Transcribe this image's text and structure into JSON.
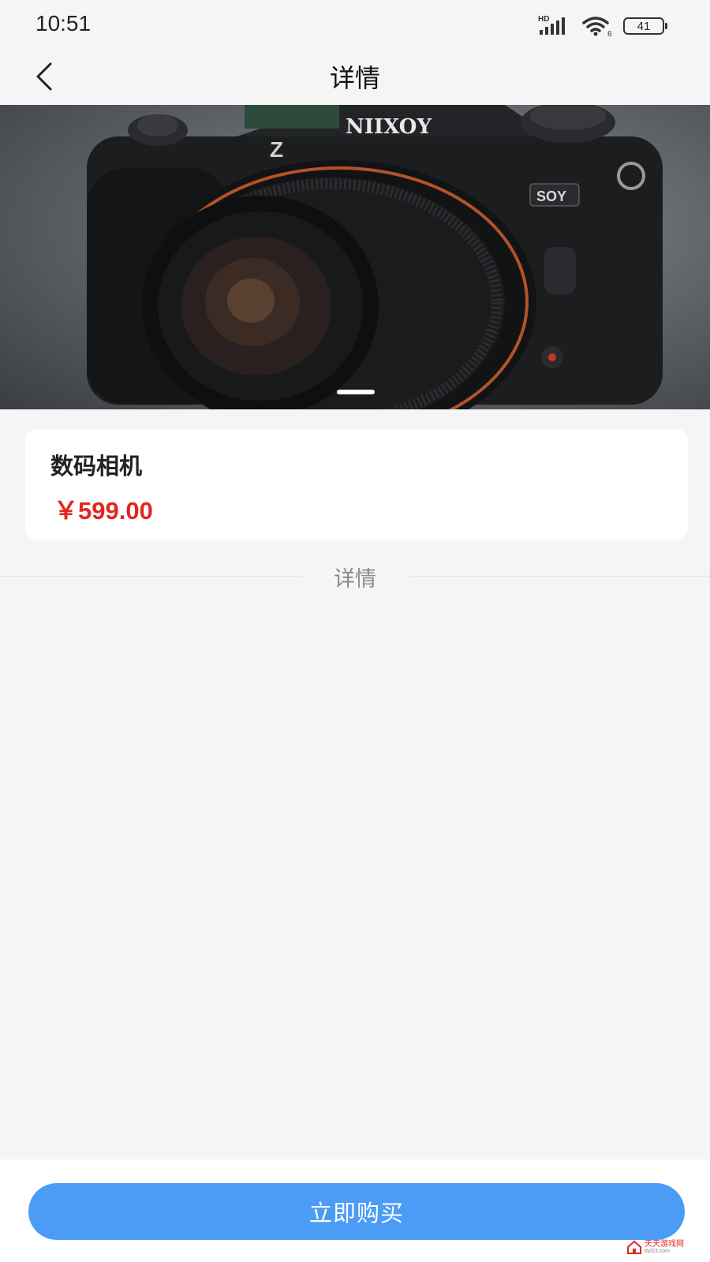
{
  "status_bar": {
    "time": "10:51",
    "network_label": "HD",
    "wifi_badge": "6",
    "battery_level": "41"
  },
  "nav": {
    "title": "详情",
    "back_icon": "chevron-left-icon"
  },
  "banner": {
    "image_description": "camera product photo",
    "brand_text": "NIIXOY",
    "model_badge": "Z",
    "side_badge": "SOY",
    "slide_count": 1,
    "active_slide": 1
  },
  "product": {
    "name": "数码相机",
    "price": "￥599.00"
  },
  "detail_section": {
    "label": "详情"
  },
  "actions": {
    "buy_label": "立即购买"
  },
  "watermark": {
    "name": "天天游戏网",
    "url": "ttyl23.com"
  },
  "colors": {
    "page_background": "#f5f5f5",
    "price_red": "#e0261e",
    "buy_button_blue": "#4a9cf5",
    "card_background": "#ffffff"
  }
}
